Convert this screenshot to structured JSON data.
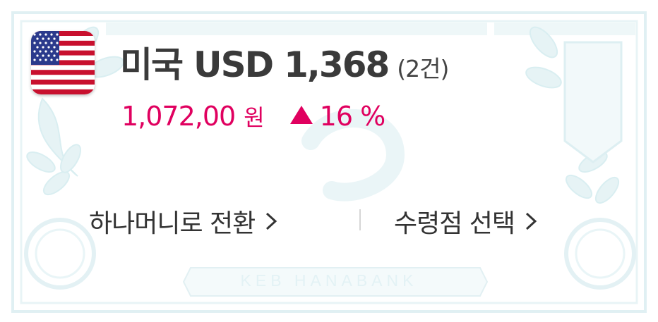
{
  "card": {
    "flag_icon": "us-flag-icon",
    "country": "미국",
    "currency_code": "USD",
    "amount": "1,368",
    "count": "(2건)",
    "rate_value": "1,072,00",
    "rate_unit": "원",
    "trend_icon": "triangle-up-icon",
    "change_percent": "16 %",
    "accent_color": "#e0005f",
    "watermark_color": "#e3f2f5"
  },
  "actions": {
    "convert_label": "하나머니로 전환",
    "branch_label": "수령점 선택"
  },
  "background": {
    "bank_name": "KEB HANABANK"
  }
}
